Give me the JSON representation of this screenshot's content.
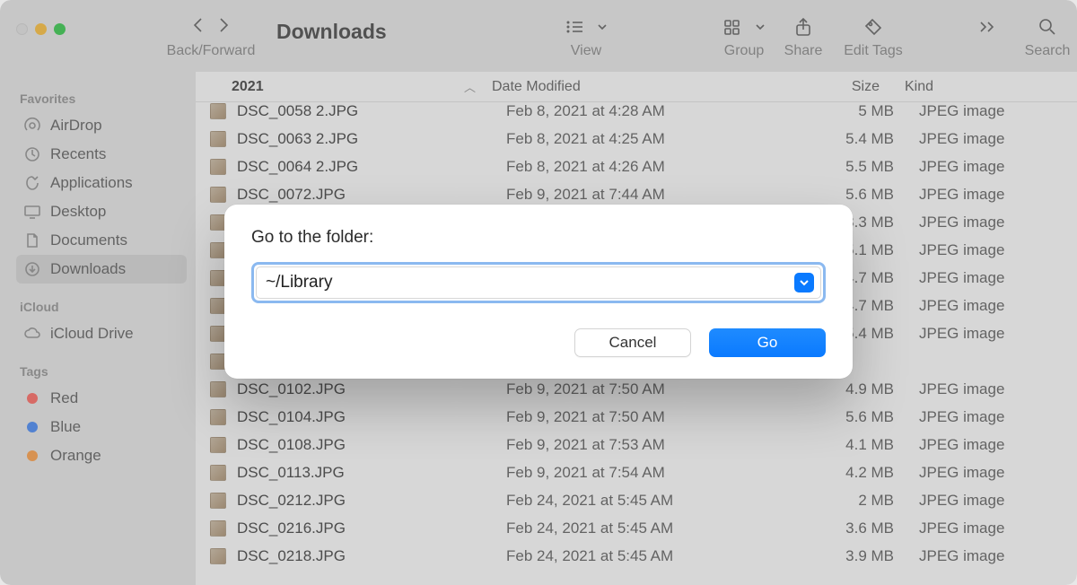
{
  "window": {
    "title": "Downloads"
  },
  "toolbar": {
    "backfwd_label": "Back/Forward",
    "view_label": "View",
    "group_label": "Group",
    "share_label": "Share",
    "tags_label": "Edit Tags",
    "search_label": "Search"
  },
  "sidebar": {
    "favorites": {
      "heading": "Favorites",
      "items": [
        {
          "label": "AirDrop",
          "icon": "airdrop"
        },
        {
          "label": "Recents",
          "icon": "clock"
        },
        {
          "label": "Applications",
          "icon": "apps"
        },
        {
          "label": "Desktop",
          "icon": "desktop"
        },
        {
          "label": "Documents",
          "icon": "documents"
        },
        {
          "label": "Downloads",
          "icon": "downloads",
          "selected": true
        }
      ]
    },
    "icloud": {
      "heading": "iCloud",
      "items": [
        {
          "label": "iCloud Drive",
          "icon": "cloud"
        }
      ]
    },
    "tags": {
      "heading": "Tags",
      "items": [
        {
          "label": "Red",
          "color": "#ff5f57"
        },
        {
          "label": "Blue",
          "color": "#3b82f6"
        },
        {
          "label": "Orange",
          "color": "#ff9a3c"
        }
      ]
    }
  },
  "columns": {
    "sort_col": "2021",
    "date": "Date Modified",
    "size": "Size",
    "kind": "Kind"
  },
  "files": [
    {
      "name": "DSC_0058 2.JPG",
      "date": "Feb 8, 2021 at 4:28 AM",
      "size": "5 MB",
      "kind": "JPEG image"
    },
    {
      "name": "DSC_0063 2.JPG",
      "date": "Feb 8, 2021 at 4:25 AM",
      "size": "5.4 MB",
      "kind": "JPEG image"
    },
    {
      "name": "DSC_0064 2.JPG",
      "date": "Feb 8, 2021 at 4:26 AM",
      "size": "5.5 MB",
      "kind": "JPEG image"
    },
    {
      "name": "DSC_0072.JPG",
      "date": "Feb 9, 2021 at 7:44 AM",
      "size": "5.6 MB",
      "kind": "JPEG image"
    },
    {
      "name": "",
      "date": "",
      "size": "3.3 MB",
      "kind": "JPEG image"
    },
    {
      "name": "",
      "date": "",
      "size": "5.1 MB",
      "kind": "JPEG image"
    },
    {
      "name": "",
      "date": "",
      "size": "4.7 MB",
      "kind": "JPEG image"
    },
    {
      "name": "",
      "date": "",
      "size": "4.7 MB",
      "kind": "JPEG image"
    },
    {
      "name": "",
      "date": "",
      "size": "5.4 MB",
      "kind": "JPEG image"
    },
    {
      "name": "",
      "date": "",
      "size": "",
      "kind": ""
    },
    {
      "name": "DSC_0102.JPG",
      "date": "Feb 9, 2021 at 7:50 AM",
      "size": "4.9 MB",
      "kind": "JPEG image"
    },
    {
      "name": "DSC_0104.JPG",
      "date": "Feb 9, 2021 at 7:50 AM",
      "size": "5.6 MB",
      "kind": "JPEG image"
    },
    {
      "name": "DSC_0108.JPG",
      "date": "Feb 9, 2021 at 7:53 AM",
      "size": "4.1 MB",
      "kind": "JPEG image"
    },
    {
      "name": "DSC_0113.JPG",
      "date": "Feb 9, 2021 at 7:54 AM",
      "size": "4.2 MB",
      "kind": "JPEG image"
    },
    {
      "name": "DSC_0212.JPG",
      "date": "Feb 24, 2021 at 5:45 AM",
      "size": "2 MB",
      "kind": "JPEG image"
    },
    {
      "name": "DSC_0216.JPG",
      "date": "Feb 24, 2021 at 5:45 AM",
      "size": "3.6 MB",
      "kind": "JPEG image"
    },
    {
      "name": "DSC_0218.JPG",
      "date": "Feb 24, 2021 at 5:45 AM",
      "size": "3.9 MB",
      "kind": "JPEG image"
    }
  ],
  "dialog": {
    "label": "Go to the folder:",
    "value": "~/Library",
    "cancel": "Cancel",
    "go": "Go"
  }
}
